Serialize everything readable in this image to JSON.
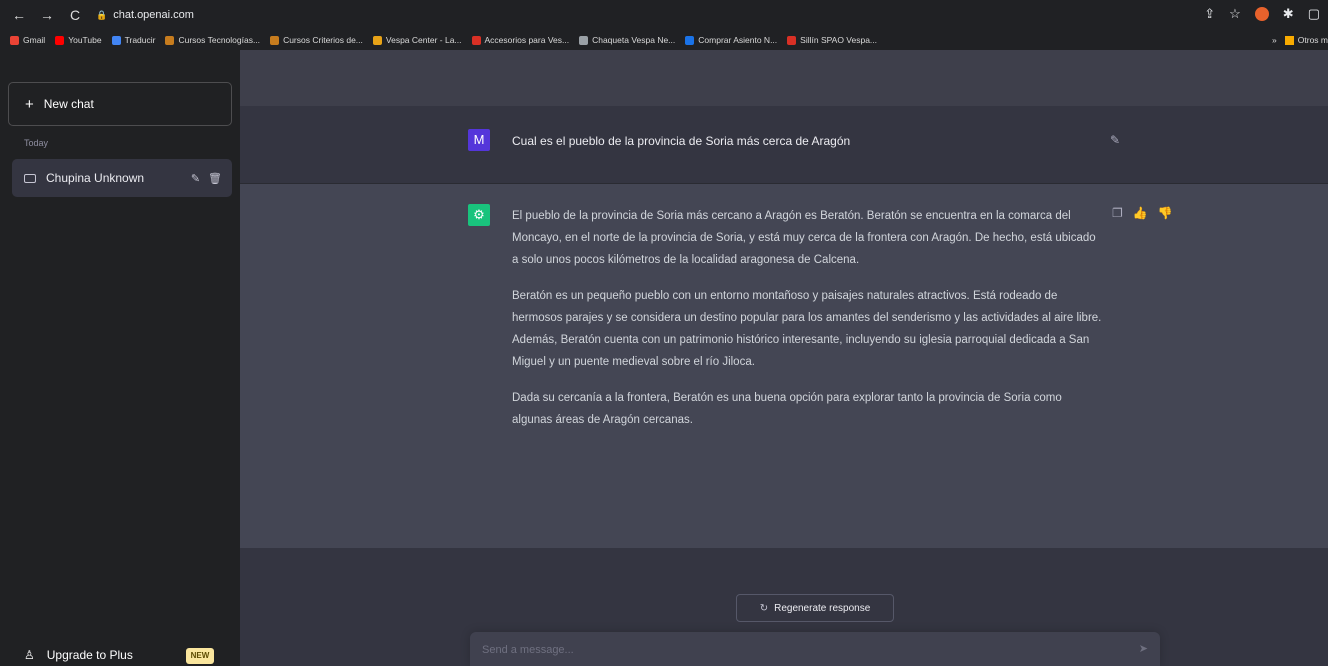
{
  "browser": {
    "url": "chat.openai.com",
    "bookmarks": [
      {
        "label": "Gmail",
        "color": "#ea4335"
      },
      {
        "label": "YouTube",
        "color": "#ff0000"
      },
      {
        "label": "Traducir",
        "color": "#4285f4"
      },
      {
        "label": "Cursos Tecnologías...",
        "color": "#c77c1e"
      },
      {
        "label": "Cursos Criterios de...",
        "color": "#c77c1e"
      },
      {
        "label": "Vespa Center - La...",
        "color": "#e8a317"
      },
      {
        "label": "Accesorios para Ves...",
        "color": "#d93025"
      },
      {
        "label": "Chaqueta Vespa Ne...",
        "color": "#9aa0a6"
      },
      {
        "label": "Comprar Asiento N...",
        "color": "#1a73e8"
      },
      {
        "label": "Sillín SPAO Vespa...",
        "color": "#d93025"
      }
    ],
    "other_bookmarks": "Otros m"
  },
  "sidebar": {
    "new_chat": "New chat",
    "section_label": "Today",
    "conversation": "Chupina Unknown",
    "upgrade": "Upgrade to Plus",
    "new_badge": "NEW"
  },
  "chat": {
    "user_initial": "M",
    "user_message": "Cual es el pueblo de la provincia de Soria más cerca de Aragón",
    "assistant_paragraphs": [
      "El pueblo de la provincia de Soria más cercano a Aragón es Beratón. Beratón se encuentra en la comarca del Moncayo, en el norte de la provincia de Soria, y está muy cerca de la frontera con Aragón. De hecho, está ubicado a solo unos pocos kilómetros de la localidad aragonesa de Calcena.",
      "Beratón es un pequeño pueblo con un entorno montañoso y paisajes naturales atractivos. Está rodeado de hermosos parajes y se considera un destino popular para los amantes del senderismo y las actividades al aire libre. Además, Beratón cuenta con un patrimonio histórico interesante, incluyendo su iglesia parroquial dedicada a San Miguel y un puente medieval sobre el río Jiloca.",
      "Dada su cercanía a la frontera, Beratón es una buena opción para explorar tanto la provincia de Soria como algunas áreas de Aragón cercanas."
    ],
    "regenerate": "Regenerate response",
    "input_placeholder": "Send a message..."
  }
}
